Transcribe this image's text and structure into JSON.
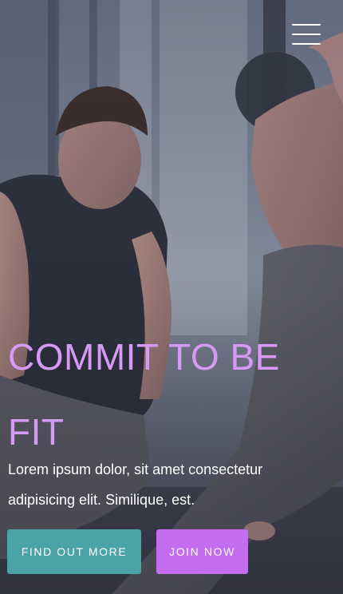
{
  "header": {
    "menu_icon": "hamburger-menu-icon"
  },
  "hero": {
    "headline": "COMMIT TO BE FIT",
    "subtext": "Lorem ipsum dolor, sit amet consectetur adipisicing elit. Similique, est.",
    "buttons": {
      "find_out_more": "FIND OUT MORE",
      "join_now": "JOIN NOW"
    }
  },
  "colors": {
    "headline": "#d79af4",
    "find_out_more_bg": "#4aa3a4",
    "join_now_bg": "#c56df0",
    "text": "#ffffff"
  }
}
